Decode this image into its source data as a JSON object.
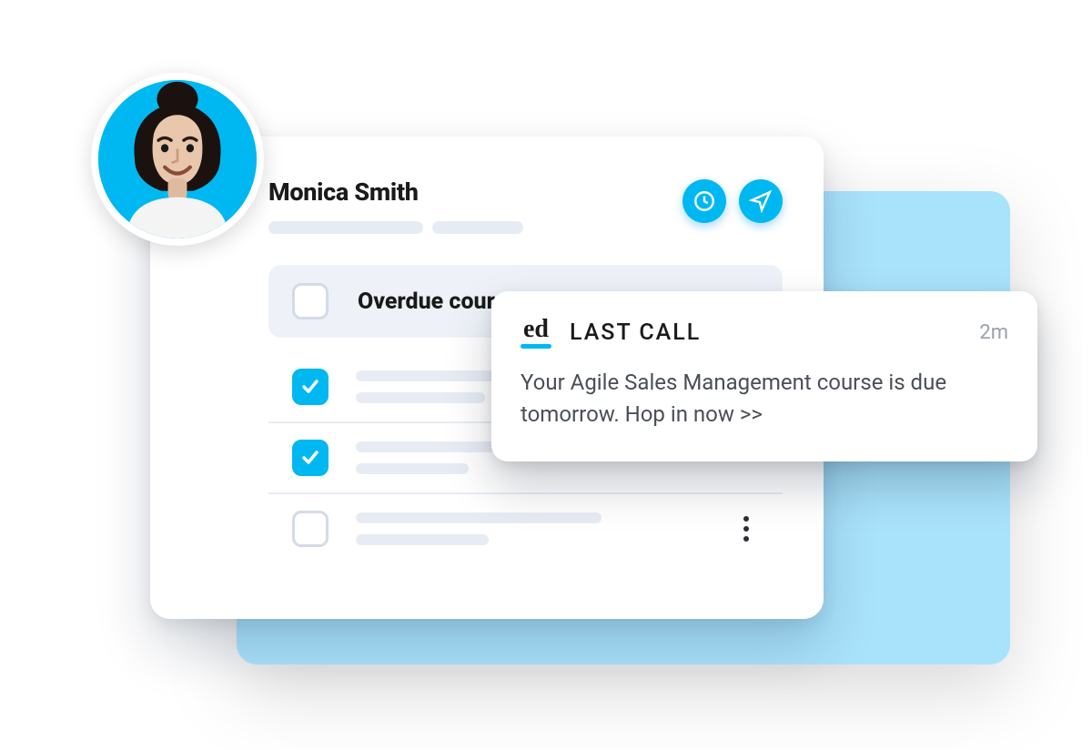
{
  "colors": {
    "accent": "#00b8f1",
    "panel": "#a9e2fb"
  },
  "user": {
    "name": "Monica Smith"
  },
  "header_actions": {
    "history_icon": "clock-icon",
    "send_icon": "paper-plane-icon"
  },
  "section": {
    "title": "Overdue courses"
  },
  "courses": [
    {
      "completed": true,
      "has_menu": false
    },
    {
      "completed": true,
      "has_menu": false
    },
    {
      "completed": false,
      "has_menu": true
    }
  ],
  "notification": {
    "logo_text": "ed",
    "title": "LAST CALL",
    "time": "2m",
    "body": "Your Agile Sales Management course is due tomorrow. Hop in now >>"
  }
}
